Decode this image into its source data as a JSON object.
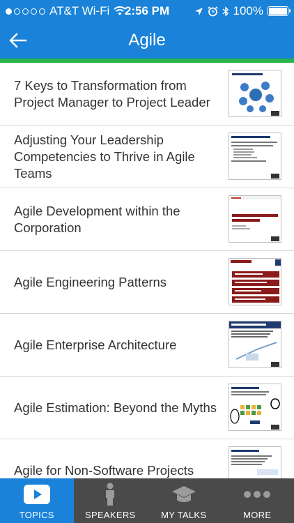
{
  "status_bar": {
    "carrier": "AT&T Wi-Fi",
    "time": "2:56 PM",
    "battery": "100%",
    "signal_bars_filled": 1,
    "signal_bars_total": 5
  },
  "nav": {
    "title": "Agile",
    "back_icon": "arrow-left-icon"
  },
  "topics": [
    {
      "title": "7 Keys to Transformation from Project Manager to Project Leader"
    },
    {
      "title": "Adjusting Your Leadership Competencies to Thrive in Agile Teams"
    },
    {
      "title": "Agile Development within the Corporation"
    },
    {
      "title": "Agile Engineering Patterns"
    },
    {
      "title": "Agile Enterprise Architecture"
    },
    {
      "title": "Agile Estimation: Beyond the Myths"
    },
    {
      "title": "Agile for Non-Software Projects"
    }
  ],
  "tabs": [
    {
      "label": "TOPICS",
      "icon": "play-icon",
      "active": true
    },
    {
      "label": "SPEAKERS",
      "icon": "person-icon",
      "active": false
    },
    {
      "label": "MY TALKS",
      "icon": "graduation-cap-icon",
      "active": false
    },
    {
      "label": "MORE",
      "icon": "more-dots-icon",
      "active": false
    }
  ],
  "colors": {
    "header_blue": "#1a82d8",
    "accent_green": "#29b34a",
    "tab_bar_gray": "#4a4a4a"
  }
}
